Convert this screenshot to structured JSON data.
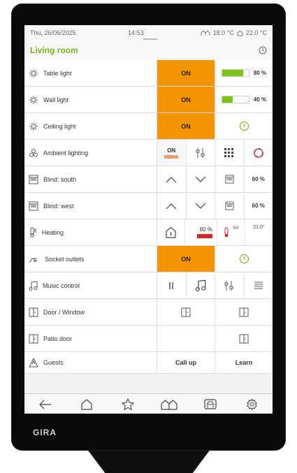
{
  "status": {
    "date": "Thu, 26/06/2025",
    "time": "14:53",
    "outdoor_temp": "18.0 °C",
    "indoor_temp": "22.0 °C"
  },
  "room": {
    "title": "Living room"
  },
  "rows": [
    {
      "label": "Table light",
      "state": "ON",
      "dim_value": 80,
      "dim_text": "80 %"
    },
    {
      "label": "Wall light",
      "state": "ON",
      "dim_value": 40,
      "dim_text": "40 %"
    },
    {
      "label": "Ceiling light",
      "state": "ON"
    },
    {
      "label": "Ambient lighting",
      "state": "ON"
    },
    {
      "label": "Blind: south",
      "position_text": "60 %"
    },
    {
      "label": "Blind: west",
      "position_text": "60 %"
    },
    {
      "label": "Heating",
      "value_text": "80 %",
      "sv_label": "SV",
      "setpoint": "21.0°"
    },
    {
      "label": "Socket outlets",
      "state": "ON"
    },
    {
      "label": "Music control"
    },
    {
      "label": "Door / Window"
    },
    {
      "label": "Patio door"
    },
    {
      "label": "Guests",
      "action1": "Call up",
      "action2": "Learn"
    }
  ],
  "brand": "GIRA",
  "colors": {
    "accent": "#f49400",
    "green": "#7bb31f",
    "bar": "#7cc414",
    "heating_red": "#d8252a"
  }
}
